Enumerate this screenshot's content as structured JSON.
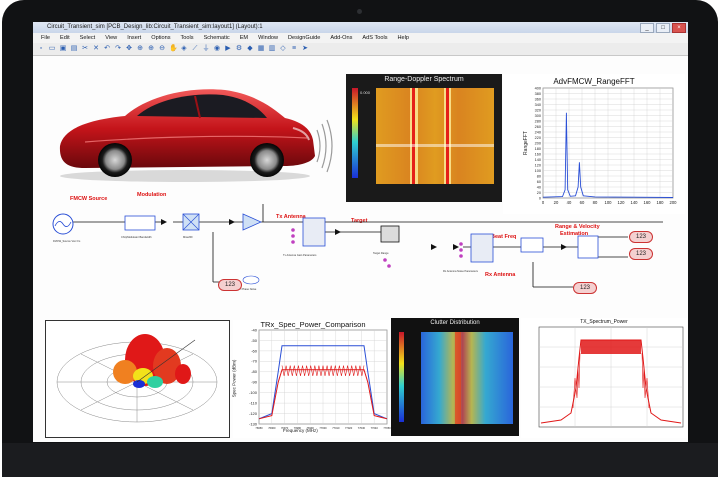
{
  "window": {
    "title": "Circuit_Transient_sim [PCB_Design_lib:Circuit_Transient_sim:layout1] (Layout):1",
    "buttons": [
      "_",
      "□",
      "×"
    ]
  },
  "menu": [
    "File",
    "Edit",
    "Select",
    "View",
    "Insert",
    "Options",
    "Tools",
    "Schematic",
    "EM",
    "Window",
    "DesignGuide",
    "Add-Ons",
    "AdS Tools",
    "Help"
  ],
  "toolbar_icons": [
    "new-icon",
    "open-icon",
    "save-icon",
    "print-icon",
    "cut-icon",
    "delete-icon",
    "undo-icon",
    "redo-icon",
    "move-icon",
    "zoom-icon",
    "zoom-in-icon",
    "zoom-out-icon",
    "pan-icon",
    "component-icon",
    "wire-icon",
    "ground-icon",
    "port-icon",
    "simulate-icon",
    "tune-icon",
    "optimize-icon",
    "data-icon",
    "layout-icon",
    "symbol-icon",
    "param-icon",
    "arrow-icon"
  ],
  "schematic": {
    "labels": {
      "fmcw_source": "FMCW Source",
      "modulation": "Modulation",
      "tx_antenna": "Tx Antenna",
      "target": "Target",
      "rx_antenna": "Rx Antenna",
      "beat_freq": "Beat Freq",
      "range_velocity": "Range & Velocity",
      "estimation": "Estimation"
    },
    "node_values": [
      "123",
      "123",
      "123",
      "123"
    ]
  },
  "charts": {
    "range_doppler": {
      "title": "Range-Doppler Spectrum"
    },
    "fft": {
      "title": "AdvFMCW_RangeFFT",
      "ylabel": "RangeFFT"
    },
    "trx": {
      "title": "TRx_Spec_Power_Comparison",
      "xlabel": "Frequency (MHz)",
      "ylabel": "Spec Power (dBm)"
    },
    "clutter": {
      "title": "Clutter Distribution"
    },
    "tx_spectrum": {
      "title": "TX_Spectrum_Power"
    }
  },
  "chart_data": [
    {
      "type": "line",
      "title": "AdvFMCW_RangeFFT",
      "ylabel": "RangeFFT",
      "x_ticks": [
        0,
        20,
        40,
        60,
        80,
        100,
        120,
        140,
        160,
        180,
        200
      ],
      "y_ticks": [
        0,
        20,
        40,
        60,
        80,
        100,
        120,
        140,
        160,
        180,
        200,
        220,
        240,
        260,
        280,
        300,
        320,
        340,
        360,
        380,
        400
      ],
      "xlim": [
        0,
        200
      ],
      "ylim": [
        0,
        400
      ],
      "grid": true,
      "series": [
        {
          "x": [
            0,
            30,
            34,
            36,
            38,
            42,
            50,
            54,
            56,
            58,
            62,
            80,
            200
          ],
          "y": [
            3,
            5,
            30,
            310,
            30,
            6,
            8,
            40,
            130,
            40,
            8,
            4,
            2
          ]
        }
      ]
    },
    {
      "type": "line",
      "title": "TRx_Spec_Power_Comparison",
      "xlabel": "Frequency (MHz)",
      "ylabel": "Spec Power (dBm)",
      "y_ticks": [
        -40,
        -50,
        -60,
        -70,
        -80,
        -90,
        -100,
        -110,
        -120,
        -130
      ],
      "x_ticks": [
        76950,
        76960,
        76970,
        76980,
        76990,
        77000,
        77010,
        77020,
        77030,
        77040,
        77050
      ],
      "ylim": [
        -130,
        -40
      ],
      "grid": true,
      "series": [
        {
          "x": [
            76950,
            76960,
            76965,
            76968,
            77032,
            77035,
            77040,
            77050
          ],
          "y": [
            -125,
            -120,
            -80,
            -55,
            -55,
            -80,
            -120,
            -125
          ]
        },
        {
          "x": [
            76950,
            76960,
            76965,
            76968,
            77032,
            77035,
            77040,
            77050
          ],
          "y": [
            -125,
            -122,
            -90,
            -78,
            -78,
            -90,
            -122,
            -125
          ]
        }
      ]
    }
  ],
  "colors": {
    "accent_blue": "#2a4fd6",
    "signal_red": "#e01818",
    "heat_yellow": "#f2e21a"
  }
}
